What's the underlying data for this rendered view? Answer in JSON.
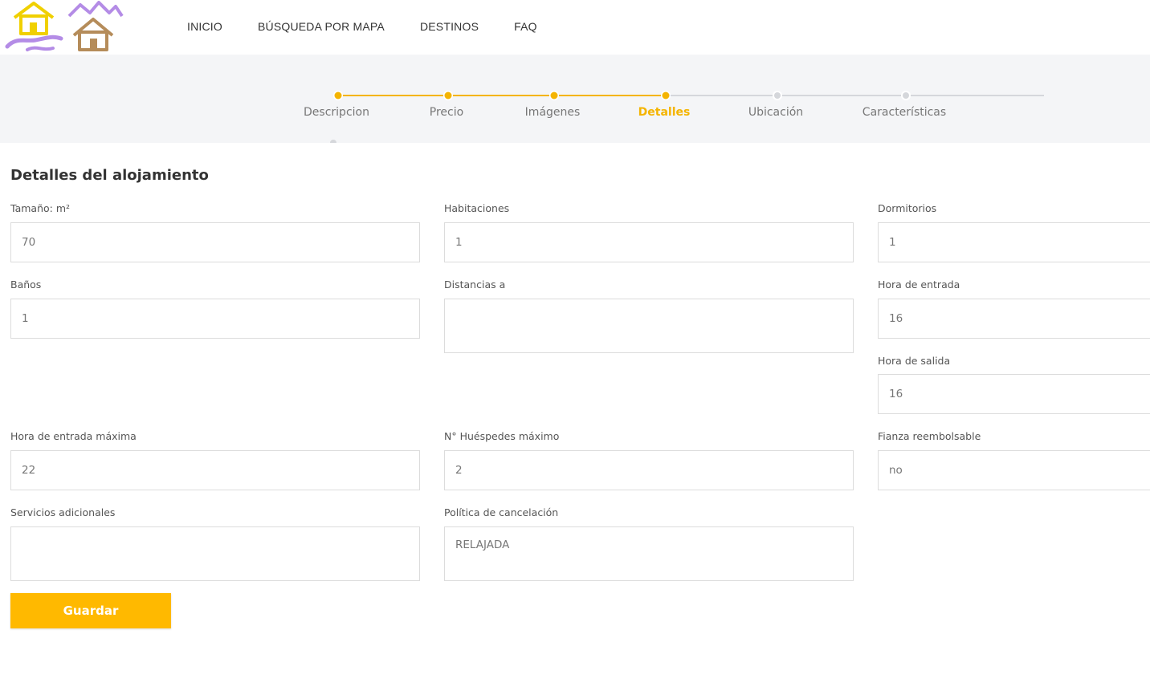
{
  "colors": {
    "accent": "#f4b400",
    "inactive": "#d5d7db",
    "logo_yellow": "#f0d000",
    "logo_purple": "#b48ce6",
    "logo_brown": "#b58c5a"
  },
  "nav": {
    "items": [
      "INICIO",
      "BÚSQUEDA POR MAPA",
      "DESTINOS",
      "FAQ"
    ]
  },
  "steps": [
    {
      "label": "Descripcion",
      "state": "done"
    },
    {
      "label": "Precio",
      "state": "done"
    },
    {
      "label": "Imágenes",
      "state": "done"
    },
    {
      "label": "Detalles",
      "state": "active"
    },
    {
      "label": "Ubicación",
      "state": "pending"
    },
    {
      "label": "Características",
      "state": "pending"
    }
  ],
  "form": {
    "title": "Detalles del alojamiento",
    "save_label": "Guardar",
    "fields": {
      "size": {
        "label": "Tamaño: m²",
        "value": "70"
      },
      "rooms": {
        "label": "Habitaciones",
        "value": "1"
      },
      "bedrooms": {
        "label": "Dormitorios",
        "value": "1"
      },
      "bathrooms": {
        "label": "Baños",
        "value": "1"
      },
      "distances": {
        "label": "Distancias a",
        "value": ""
      },
      "checkin": {
        "label": "Hora de entrada",
        "value": "16"
      },
      "checkout": {
        "label": "Hora de salida",
        "value": "16"
      },
      "max_checkin": {
        "label": "Hora de entrada máxima",
        "value": "22"
      },
      "max_guests": {
        "label": "N° Huéspedes máximo",
        "value": "2"
      },
      "deposit": {
        "label": "Fianza reembolsable",
        "value": "no"
      },
      "extra_services": {
        "label": "Servicios adicionales",
        "value": ""
      },
      "cancellation": {
        "label": "Política de cancelación",
        "value": "RELAJADA"
      }
    }
  }
}
